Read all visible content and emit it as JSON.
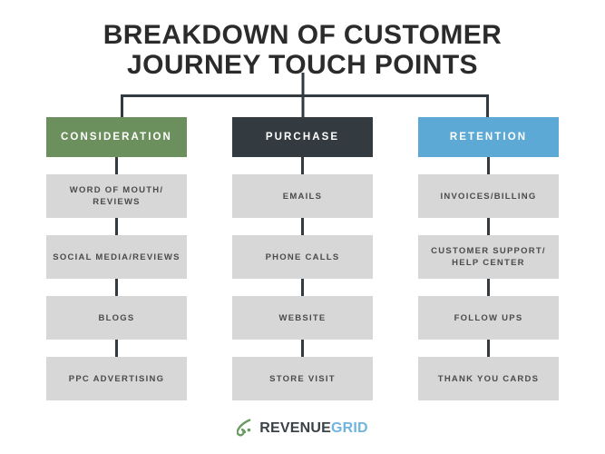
{
  "title": {
    "line1": "BREAKDOWN OF CUSTOMER",
    "line2": "JOURNEY TOUCH POINTS"
  },
  "colors": {
    "consideration": "#6b8f5d",
    "purchase": "#333b40",
    "retention": "#5ca9d6",
    "item_box": "#d7d7d7",
    "item_text": "#4b4b4b",
    "connector": "#333b40",
    "title_text": "#2b2b2b",
    "background": "#ffffff",
    "logo_dark": "#3b4247",
    "logo_blue": "#6fb5e0",
    "logo_mark": "#6b9a63"
  },
  "columns": [
    {
      "header": "CONSIDERATION",
      "items": [
        "WORD OF MOUTH/\nREVIEWS",
        "SOCIAL MEDIA/REVIEWS",
        "BLOGS",
        "PPC ADVERTISING"
      ]
    },
    {
      "header": "PURCHASE",
      "items": [
        "EMAILS",
        "PHONE CALLS",
        "WEBSITE",
        "STORE VISIT"
      ]
    },
    {
      "header": "RETENTION",
      "items": [
        "INVOICES/BILLING",
        "CUSTOMER SUPPORT/\nHELP CENTER",
        "FOLLOW UPS",
        "THANK YOU CARDS"
      ]
    }
  ],
  "logo": {
    "mark": "leaf-swoosh-icon",
    "name_part1": "REVENUE",
    "name_part2": "GRID"
  }
}
